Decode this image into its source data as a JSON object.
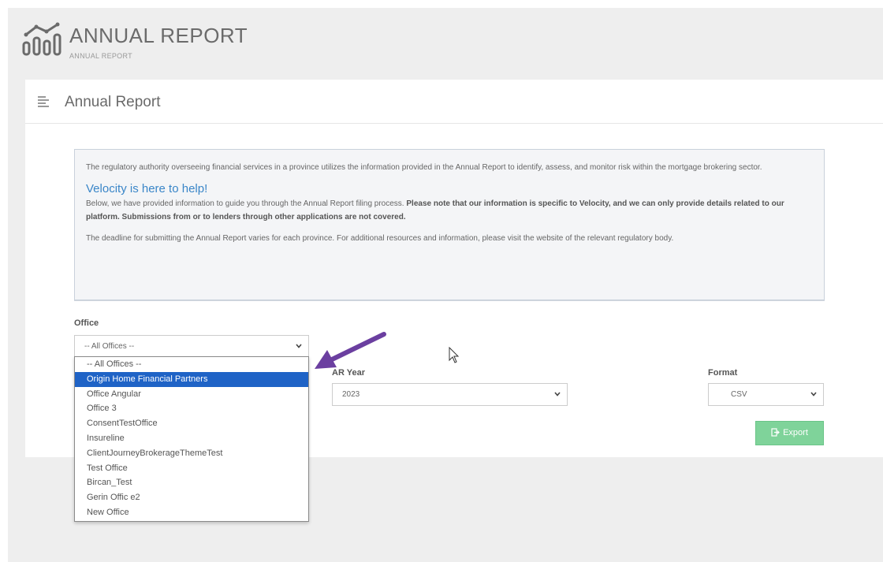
{
  "app": {
    "title": "ANNUAL REPORT",
    "subtitle": "ANNUAL REPORT"
  },
  "panel": {
    "title": "Annual Report"
  },
  "info": {
    "paragraph1": "The regulatory authority overseeing financial services in a province utilizes the information provided in the Annual Report to identify, assess, and monitor risk within the mortgage brokering sector.",
    "heading": "Velocity is here to help!",
    "paragraph2_intro": "Below, we have provided information to guide you through the Annual Report filing process. ",
    "paragraph2_bold": "Please note that our information is specific to Velocity, and we can only provide details related to our platform. Submissions from or to lenders through other applications are not covered.",
    "paragraph3": "The deadline for submitting the Annual Report varies for each province. For additional resources and information, please visit the website of the relevant regulatory body."
  },
  "office": {
    "label": "Office",
    "value": "-- All Offices --",
    "options": [
      "-- All Offices --",
      "Origin Home Financial Partners",
      "Office Angular",
      "Office 3",
      "ConsentTestOffice",
      "Insureline",
      "ClientJourneyBrokerageThemeTest",
      "Test Office",
      "Bircan_Test",
      "Gerin Offic e2",
      "New Office"
    ],
    "highlighted_index": 1
  },
  "year": {
    "label": "AR Year",
    "value": "2023"
  },
  "format": {
    "label": "Format",
    "value": "CSV"
  },
  "export": {
    "label": "Export"
  },
  "colors": {
    "accent_blue": "#3a86c8",
    "selection_blue": "#1f63c6",
    "export_green": "#7fd39a",
    "arrow_purple": "#6b3fa0"
  },
  "icons": {
    "logo": "bar-chart-line-icon",
    "menu": "hamburger-menu-icon",
    "dropdown": "chevron-down-icon",
    "export": "export-icon",
    "annotation": "arrow-annotation",
    "pointer": "mouse-cursor-icon"
  }
}
